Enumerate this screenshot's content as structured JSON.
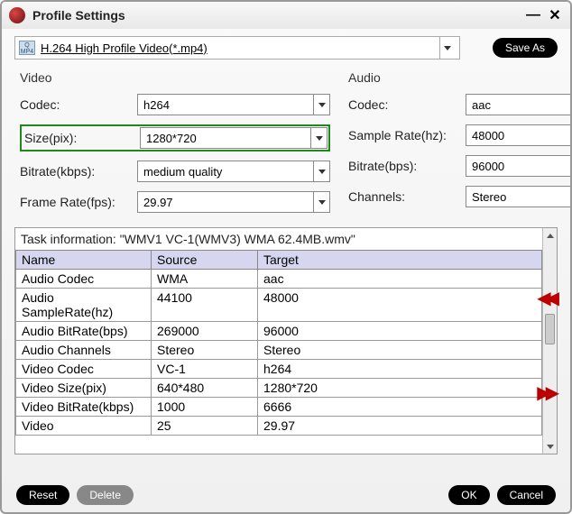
{
  "window": {
    "title": "Profile Settings"
  },
  "profile": {
    "current": "H.264 High Profile Video(*.mp4)",
    "iconText": "MP4"
  },
  "buttons": {
    "saveAs": "Save As",
    "reset": "Reset",
    "delete": "Delete",
    "ok": "OK",
    "cancel": "Cancel"
  },
  "video": {
    "legend": "Video",
    "codec": {
      "label": "Codec:",
      "value": "h264"
    },
    "size": {
      "label": "Size(pix):",
      "value": "1280*720"
    },
    "bitrate": {
      "label": "Bitrate(kbps):",
      "value": "medium quality"
    },
    "fps": {
      "label": "Frame Rate(fps):",
      "value": "29.97"
    }
  },
  "audio": {
    "legend": "Audio",
    "codec": {
      "label": "Codec:",
      "value": "aac"
    },
    "sr": {
      "label": "Sample Rate(hz):",
      "value": "48000"
    },
    "bitrate": {
      "label": "Bitrate(bps):",
      "value": "96000"
    },
    "channels": {
      "label": "Channels:",
      "value": "Stereo"
    }
  },
  "task": {
    "info": "Task information: \"WMV1 VC-1(WMV3) WMA 62.4MB.wmv\"",
    "headers": {
      "name": "Name",
      "source": "Source",
      "target": "Target"
    },
    "rows": [
      {
        "n": "Audio Codec",
        "s": "WMA",
        "t": "aac"
      },
      {
        "n": "Audio SampleRate(hz)",
        "s": "44100",
        "t": "48000"
      },
      {
        "n": "Audio BitRate(bps)",
        "s": "269000",
        "t": "96000"
      },
      {
        "n": "Audio Channels",
        "s": "Stereo",
        "t": "Stereo"
      },
      {
        "n": "Video Codec",
        "s": "VC-1",
        "t": "h264"
      },
      {
        "n": "Video Size(pix)",
        "s": "640*480",
        "t": "1280*720"
      },
      {
        "n": "Video BitRate(kbps)",
        "s": "1000",
        "t": "6666"
      },
      {
        "n": "Video",
        "s": "25",
        "t": "29.97"
      }
    ]
  }
}
